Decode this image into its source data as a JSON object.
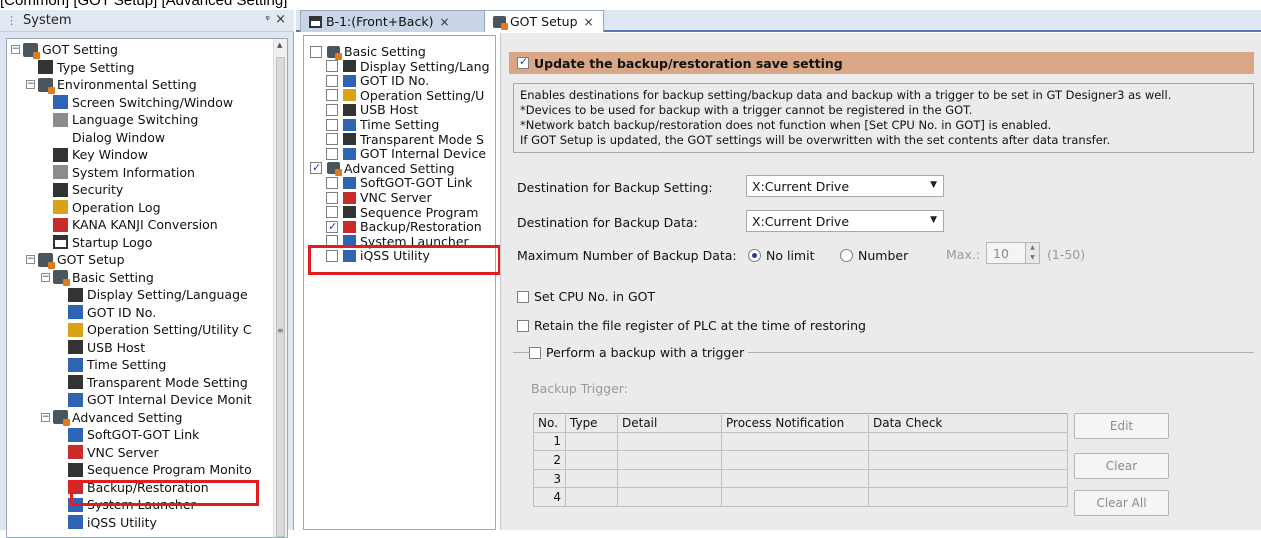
{
  "caption": "[Common] [GOT Setup] [Advanced Setting]",
  "system_panel": {
    "title": "System",
    "pin": "ᵠ",
    "close": "×",
    "tree": [
      {
        "label": "GOT Setting",
        "icon": "got-setting-icon",
        "toggle": "−"
      },
      {
        "label": "Type Setting",
        "icon": "type-setting-icon"
      },
      {
        "label": "Environmental Setting",
        "icon": "folder-settings-icon",
        "toggle": "−"
      },
      {
        "label": "Screen Switching/Window",
        "icon": "screen-switch-icon"
      },
      {
        "label": "Language Switching",
        "icon": "language-icon"
      },
      {
        "label": "Dialog Window",
        "icon": "warning-icon"
      },
      {
        "label": "Key Window",
        "icon": "key-window-icon"
      },
      {
        "label": "System Information",
        "icon": "system-info-icon"
      },
      {
        "label": "Security",
        "icon": "security-icon"
      },
      {
        "label": "Operation Log",
        "icon": "operation-log-icon"
      },
      {
        "label": "KANA KANJI Conversion",
        "icon": "kana-kanji-icon"
      },
      {
        "label": "Startup Logo",
        "icon": "startup-logo-icon"
      },
      {
        "label": "GOT Setup",
        "icon": "got-setup-icon",
        "toggle": "−"
      },
      {
        "label": "Basic Setting",
        "icon": "folder-settings-icon",
        "toggle": "−"
      },
      {
        "label": "Display Setting/Language",
        "icon": "display-icon"
      },
      {
        "label": "GOT ID No.",
        "icon": "id-icon"
      },
      {
        "label": "Operation Setting/Utility C",
        "icon": "operation-setting-icon"
      },
      {
        "label": "USB Host",
        "icon": "usb-icon"
      },
      {
        "label": "Time Setting",
        "icon": "clock-icon"
      },
      {
        "label": "Transparent Mode Setting",
        "icon": "transparent-mode-icon"
      },
      {
        "label": "GOT Internal Device Monit",
        "icon": "internal-device-icon"
      },
      {
        "label": "Advanced Setting",
        "icon": "folder-advanced-icon",
        "toggle": "−"
      },
      {
        "label": "SoftGOT-GOT Link",
        "icon": "link-icon"
      },
      {
        "label": "VNC Server",
        "icon": "vnc-icon"
      },
      {
        "label": "Sequence Program Monito",
        "icon": "sequence-icon"
      },
      {
        "label": "Backup/Restoration",
        "icon": "backup-icon"
      },
      {
        "label": "System Launcher",
        "icon": "launcher-icon"
      },
      {
        "label": "iQSS Utility",
        "icon": "iqss-icon"
      }
    ]
  },
  "tabs": [
    {
      "label": "B-1:(Front+Back)",
      "close": "×",
      "icon": "screen-tab-icon"
    },
    {
      "label": "GOT Setup",
      "close": "×",
      "icon": "got-setup-icon"
    }
  ],
  "mid_tree": [
    {
      "label": "Basic Setting",
      "icon": "folder-settings-icon",
      "checked": false
    },
    {
      "label": "Display Setting/Lang",
      "icon": "display-icon",
      "checked": false
    },
    {
      "label": "GOT ID No.",
      "icon": "id-icon",
      "checked": false
    },
    {
      "label": "Operation Setting/U",
      "icon": "operation-setting-icon",
      "checked": false
    },
    {
      "label": "USB Host",
      "icon": "usb-icon",
      "checked": false
    },
    {
      "label": "Time Setting",
      "icon": "clock-icon",
      "checked": false
    },
    {
      "label": "Transparent Mode S",
      "icon": "transparent-mode-icon",
      "checked": false
    },
    {
      "label": "GOT Internal Device",
      "icon": "internal-device-icon",
      "checked": false
    },
    {
      "label": "Advanced Setting",
      "icon": "folder-advanced-icon",
      "checked": true
    },
    {
      "label": "SoftGOT-GOT Link",
      "icon": "link-icon",
      "checked": false
    },
    {
      "label": "VNC Server",
      "icon": "vnc-icon",
      "checked": false
    },
    {
      "label": "Sequence Program",
      "icon": "sequence-icon",
      "checked": false
    },
    {
      "label": "Backup/Restoration",
      "icon": "backup-icon",
      "checked": true
    },
    {
      "label": "System Launcher",
      "icon": "launcher-icon",
      "checked": false
    },
    {
      "label": "iQSS Utility",
      "icon": "iqss-icon",
      "checked": false
    }
  ],
  "settings": {
    "update_label": "Update the backup/restoration save setting",
    "update_checked": true,
    "description": [
      "Enables destinations for backup setting/backup data and backup with a trigger to be set in GT Designer3 as well.",
      "*Devices to be used for backup with a trigger cannot be registered in the GOT.",
      "*Network batch backup/restoration does not function when [Set CPU No. in GOT] is enabled.",
      "If GOT Setup is updated, the GOT settings will be overwritten with the set contents after data transfer."
    ],
    "dest_setting_label": "Destination for Backup Setting:",
    "dest_setting_value": "X:Current Drive",
    "dest_data_label": "Destination for Backup Data:",
    "dest_data_value": "X:Current Drive",
    "max_label": "Maximum Number of Backup Data:",
    "radio_nolimit": "No limit",
    "radio_number": "Number",
    "max_prefix": "Max.:",
    "max_value": "10",
    "max_range": "(1-50)",
    "set_cpu_label": "Set CPU No. in GOT",
    "retain_label": "Retain the file register of PLC at the time of restoring",
    "trigger_label": "Perform a backup with a trigger",
    "backup_trigger_label": "Backup Trigger:",
    "table": {
      "headers": [
        "No.",
        "Type",
        "Detail",
        "Process Notification",
        "Data Check"
      ],
      "rows": [
        "1",
        "2",
        "3",
        "4"
      ]
    },
    "buttons": {
      "edit": "Edit",
      "clear": "Clear",
      "clear_all": "Clear All"
    }
  }
}
